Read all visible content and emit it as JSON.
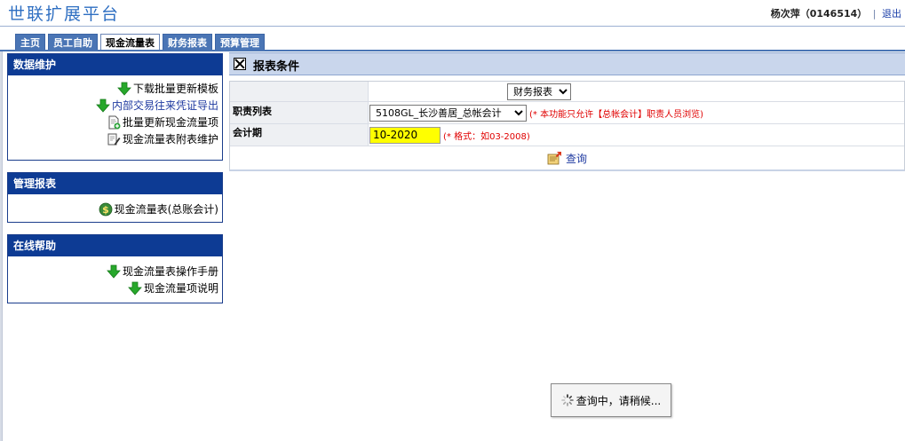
{
  "header": {
    "brand": "世联扩展平台",
    "user": "杨次萍（0146514）",
    "separator": "|",
    "logout": "退出"
  },
  "tabs": [
    {
      "label": "主页",
      "active": false
    },
    {
      "label": "员工自助",
      "active": false
    },
    {
      "label": "现金流量表",
      "active": true
    },
    {
      "label": "财务报表",
      "active": false
    },
    {
      "label": "预算管理",
      "active": false
    }
  ],
  "sidebar": {
    "data_maintenance": {
      "title": "数据维护",
      "items": [
        {
          "label": "下载批量更新模板",
          "icon": "down-arrow-icon"
        },
        {
          "label": "内部交易往来凭证导出",
          "icon": "down-arrow-icon"
        },
        {
          "label": "批量更新现金流量项",
          "icon": "doc-add-icon"
        },
        {
          "label": "现金流量表附表维护",
          "icon": "doc-edit-icon"
        }
      ]
    },
    "management_reports": {
      "title": "管理报表",
      "items": [
        {
          "label": "现金流量表(总账会计)",
          "icon": "dollar-icon"
        }
      ]
    },
    "online_help": {
      "title": "在线帮助",
      "items": [
        {
          "label": "现金流量表操作手册",
          "icon": "down-arrow-icon"
        },
        {
          "label": "现金流量项说明",
          "icon": "down-arrow-icon"
        }
      ]
    }
  },
  "report": {
    "title": "报表条件",
    "report_type_value": "财务报表",
    "duty_label": "职责列表",
    "duty_value": "5108GL_长沙善居_总帐会计",
    "duty_note": "(* 本功能只允许【总帐会计】职责人员浏览)",
    "period_label": "会计期",
    "period_value": "10-2020",
    "period_note": "(* 格式：如03-2008)",
    "query_label": "查询"
  },
  "loading": {
    "text": "查询中，请稍候..."
  },
  "colors": {
    "brand": "#2f6fc2",
    "tab": "#4a75b5",
    "panel_title": "#0d3b94",
    "report_header": "#c9d6ec",
    "highlight": "#ffff00",
    "note": "#e00000"
  }
}
